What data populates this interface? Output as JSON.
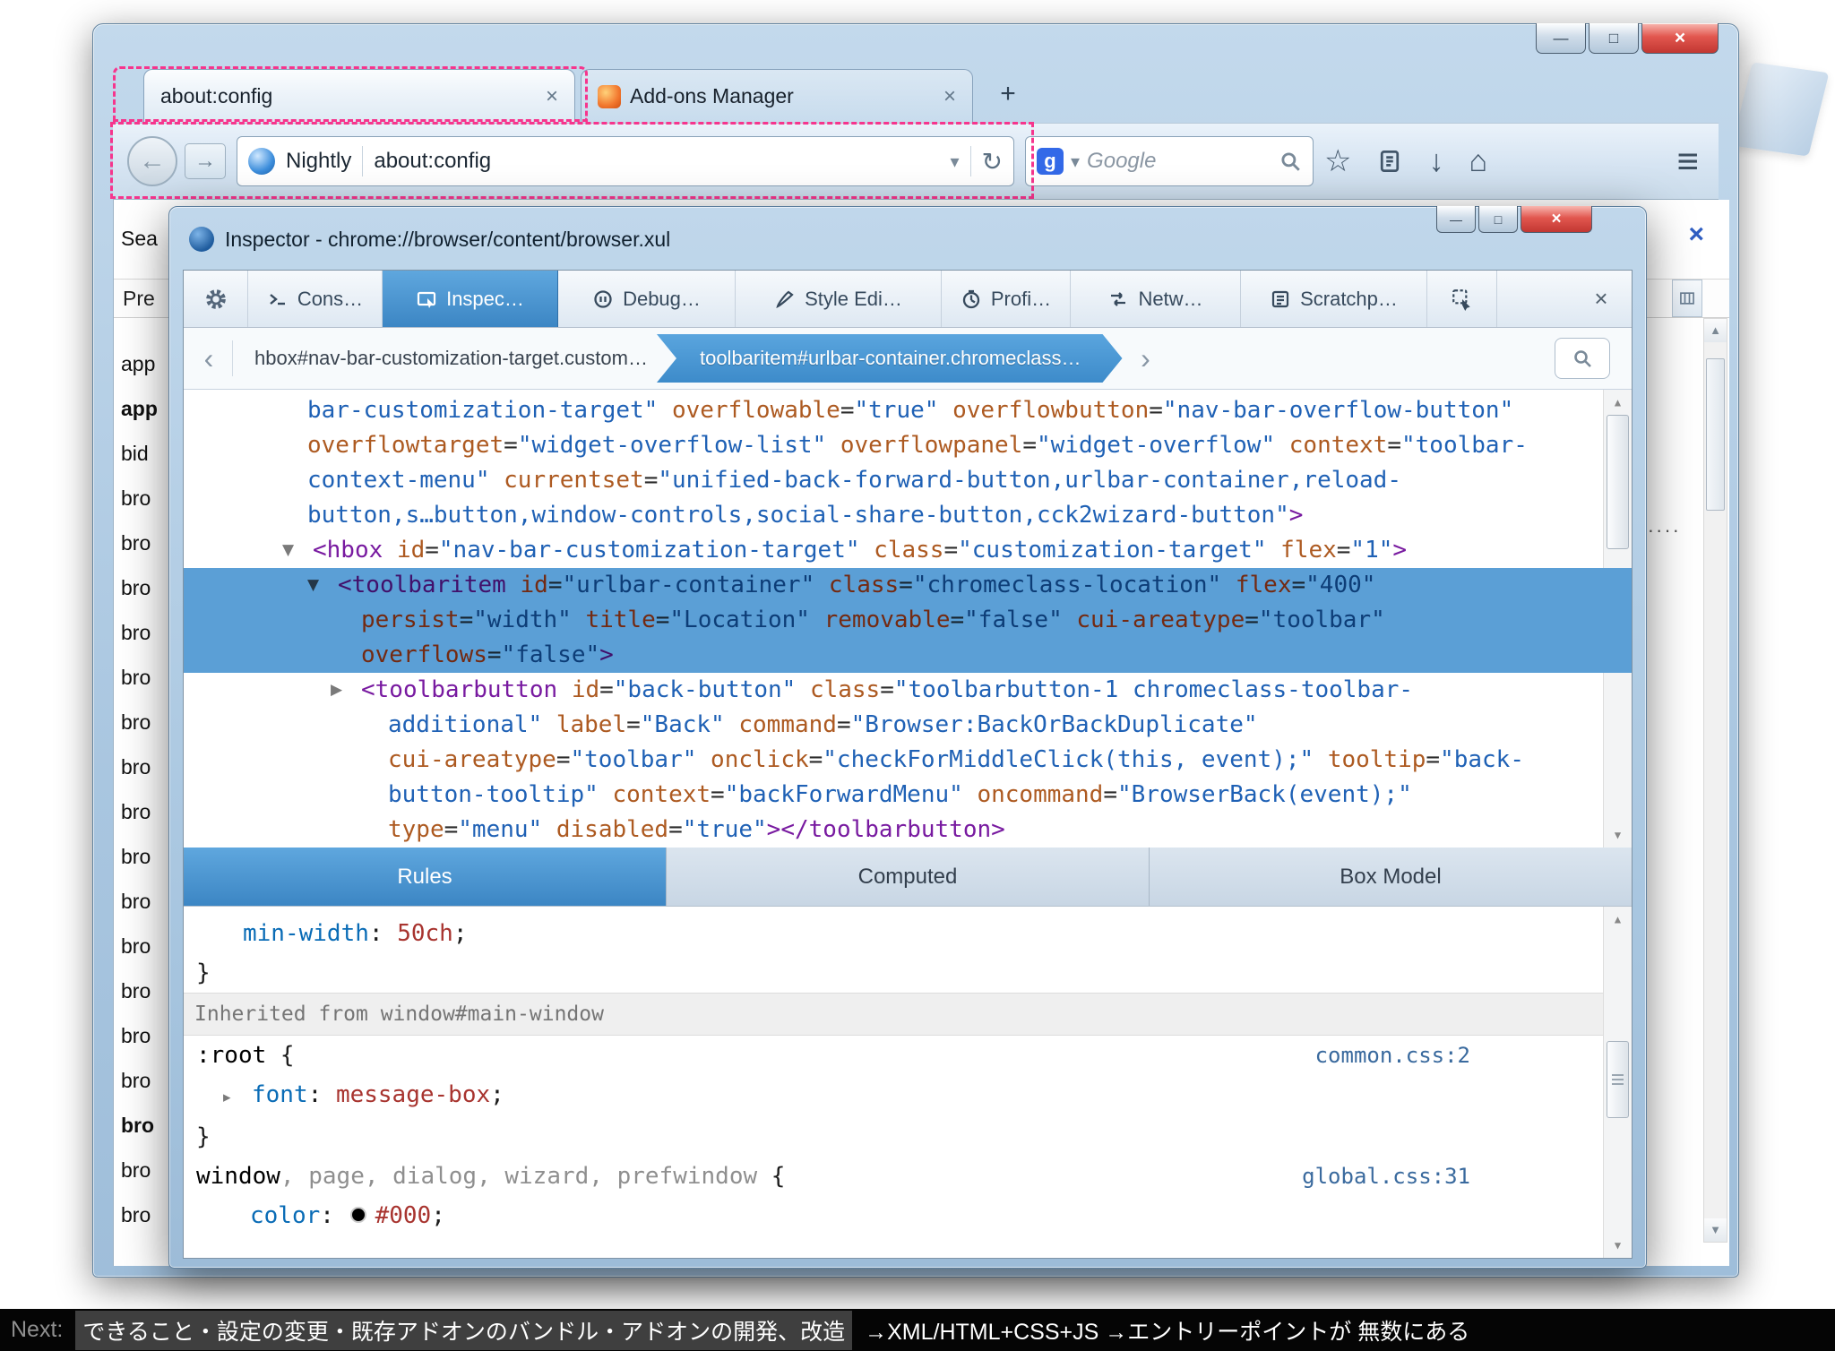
{
  "icons": {
    "close": "×",
    "minimize": "—",
    "maximize": "□",
    "plus": "+",
    "back": "←",
    "forward": "→",
    "dropdown": "▾",
    "reload": "↻",
    "star": "☆",
    "downloads": "↓",
    "home": "⌂",
    "menu": "≡",
    "chevron_left": "‹",
    "chevron_right": "›",
    "scroll_up": "▲",
    "scroll_down": "▼",
    "search_clear": "×",
    "google_glyph": "g"
  },
  "browser": {
    "tabs": [
      {
        "label": "about:config",
        "active": true
      },
      {
        "label": "Add-ons Manager",
        "active": false
      }
    ],
    "navbar": {
      "site_button_label": "Nightly",
      "url_value": "about:config",
      "search_placeholder": "Google"
    }
  },
  "about_config": {
    "search_label": "Sea",
    "header_label": "Pre",
    "truncated_value": "····",
    "rows": [
      {
        "t": "app"
      },
      {
        "t": "app",
        "b": true
      },
      {
        "t": "bid"
      },
      {
        "t": "bro"
      },
      {
        "t": "bro"
      },
      {
        "t": "bro"
      },
      {
        "t": "bro"
      },
      {
        "t": "bro"
      },
      {
        "t": "bro"
      },
      {
        "t": "bro"
      },
      {
        "t": "bro"
      },
      {
        "t": "bro"
      },
      {
        "t": "bro"
      },
      {
        "t": "bro"
      },
      {
        "t": "bro"
      },
      {
        "t": "bro"
      },
      {
        "t": "bro"
      },
      {
        "t": "bro",
        "b": true
      },
      {
        "t": "bro"
      },
      {
        "t": "bro"
      }
    ]
  },
  "inspector": {
    "title": "Inspector - chrome://browser/content/browser.xul",
    "toolbar": {
      "tabs": [
        {
          "label": "Cons…"
        },
        {
          "label": "Inspec…",
          "selected": true
        },
        {
          "label": "Debug…"
        },
        {
          "label": "Style Edi…"
        },
        {
          "label": "Profi…"
        },
        {
          "label": "Netw…"
        },
        {
          "label": "Scratchp…"
        }
      ]
    },
    "breadcrumbs": {
      "items": [
        {
          "label": "hbox#nav-bar-customization-target.custom…",
          "selected": false
        },
        {
          "label": "toolbaritem#urlbar-container.chromeclass…",
          "selected": true
        }
      ]
    },
    "markup": {
      "lines": [
        {
          "pad": 138,
          "segs": [
            [
              "v",
              "bar-customization-target\" "
            ],
            [
              "a",
              "overflowable"
            ],
            [
              "p",
              "="
            ],
            [
              "v",
              "\"true\""
            ],
            [
              "p",
              " "
            ],
            [
              "a",
              "overflowbutton"
            ],
            [
              "p",
              "="
            ],
            [
              "v",
              "\"nav-bar-overflow-button\""
            ]
          ]
        },
        {
          "pad": 138,
          "segs": [
            [
              "a",
              "overflowtarget"
            ],
            [
              "p",
              "="
            ],
            [
              "v",
              "\"widget-overflow-list\""
            ],
            [
              "p",
              " "
            ],
            [
              "a",
              "overflowpanel"
            ],
            [
              "p",
              "="
            ],
            [
              "v",
              "\"widget-overflow\""
            ],
            [
              "p",
              " "
            ],
            [
              "a",
              "context"
            ],
            [
              "p",
              "="
            ],
            [
              "v",
              "\"toolbar-"
            ]
          ]
        },
        {
          "pad": 138,
          "segs": [
            [
              "v",
              "context-menu\" "
            ],
            [
              "a",
              "currentset"
            ],
            [
              "p",
              "="
            ],
            [
              "v",
              "\"unified-back-forward-button,urlbar-container,reload-"
            ]
          ]
        },
        {
          "pad": 138,
          "segs": [
            [
              "v",
              "button,s…button,window-controls,social-share-button,cck2wizard-button\""
            ],
            [
              "t",
              ">"
            ]
          ]
        },
        {
          "pad": 144,
          "tw": "▼",
          "segs": [
            [
              "t",
              "<hbox"
            ],
            [
              "p",
              " "
            ],
            [
              "a",
              "id"
            ],
            [
              "p",
              "="
            ],
            [
              "v",
              "\"nav-bar-customization-target\""
            ],
            [
              "p",
              " "
            ],
            [
              "a",
              "class"
            ],
            [
              "p",
              "="
            ],
            [
              "v",
              "\"customization-target\""
            ],
            [
              "p",
              " "
            ],
            [
              "a",
              "flex"
            ],
            [
              "p",
              "="
            ],
            [
              "v",
              "\"1\""
            ],
            [
              "t",
              ">"
            ]
          ]
        },
        {
          "pad": 172,
          "tw": "▼",
          "sel": true,
          "segs": [
            [
              "t",
              "<toolbaritem"
            ],
            [
              "p",
              " "
            ],
            [
              "a",
              "id"
            ],
            [
              "p",
              "="
            ],
            [
              "v",
              "\"urlbar-container\""
            ],
            [
              "p",
              " "
            ],
            [
              "a",
              "class"
            ],
            [
              "p",
              "="
            ],
            [
              "v",
              "\"chromeclass-location\""
            ],
            [
              "p",
              " "
            ],
            [
              "a",
              "flex"
            ],
            [
              "p",
              "="
            ],
            [
              "v",
              "\"400\""
            ]
          ]
        },
        {
          "pad": 198,
          "sel": true,
          "segs": [
            [
              "a",
              "persist"
            ],
            [
              "p",
              "="
            ],
            [
              "v",
              "\"width\""
            ],
            [
              "p",
              " "
            ],
            [
              "a",
              "title"
            ],
            [
              "p",
              "="
            ],
            [
              "v",
              "\"Location\""
            ],
            [
              "p",
              " "
            ],
            [
              "a",
              "removable"
            ],
            [
              "p",
              "="
            ],
            [
              "v",
              "\"false\""
            ],
            [
              "p",
              " "
            ],
            [
              "a",
              "cui-areatype"
            ],
            [
              "p",
              "="
            ],
            [
              "v",
              "\"toolbar\""
            ]
          ]
        },
        {
          "pad": 198,
          "sel": true,
          "segs": [
            [
              "a",
              "overflows"
            ],
            [
              "p",
              "="
            ],
            [
              "v",
              "\"false\""
            ],
            [
              "t",
              ">"
            ]
          ]
        },
        {
          "pad": 198,
          "tw": "▶",
          "segs": [
            [
              "t",
              "<toolbarbutton"
            ],
            [
              "p",
              " "
            ],
            [
              "a",
              "id"
            ],
            [
              "p",
              "="
            ],
            [
              "v",
              "\"back-button\""
            ],
            [
              "p",
              " "
            ],
            [
              "a",
              "class"
            ],
            [
              "p",
              "="
            ],
            [
              "v",
              "\"toolbarbutton-1 chromeclass-toolbar-"
            ]
          ]
        },
        {
          "pad": 228,
          "segs": [
            [
              "v",
              "additional\" "
            ],
            [
              "a",
              "label"
            ],
            [
              "p",
              "="
            ],
            [
              "v",
              "\"Back\""
            ],
            [
              "p",
              " "
            ],
            [
              "a",
              "command"
            ],
            [
              "p",
              "="
            ],
            [
              "v",
              "\"Browser:BackOrBackDuplicate\""
            ]
          ]
        },
        {
          "pad": 228,
          "segs": [
            [
              "a",
              "cui-areatype"
            ],
            [
              "p",
              "="
            ],
            [
              "v",
              "\"toolbar\""
            ],
            [
              "p",
              " "
            ],
            [
              "a",
              "onclick"
            ],
            [
              "p",
              "="
            ],
            [
              "v",
              "\"checkForMiddleClick(this, event);\""
            ],
            [
              "p",
              " "
            ],
            [
              "a",
              "tooltip"
            ],
            [
              "p",
              "="
            ],
            [
              "v",
              "\"back-"
            ]
          ]
        },
        {
          "pad": 228,
          "segs": [
            [
              "v",
              "button-tooltip\" "
            ],
            [
              "a",
              "context"
            ],
            [
              "p",
              "="
            ],
            [
              "v",
              "\"backForwardMenu\""
            ],
            [
              "p",
              " "
            ],
            [
              "a",
              "oncommand"
            ],
            [
              "p",
              "="
            ],
            [
              "v",
              "\"BrowserBack(event);\""
            ]
          ]
        },
        {
          "pad": 228,
          "segs": [
            [
              "a",
              "type"
            ],
            [
              "p",
              "="
            ],
            [
              "v",
              "\"menu\""
            ],
            [
              "p",
              " "
            ],
            [
              "a",
              "disabled"
            ],
            [
              "p",
              "="
            ],
            [
              "v",
              "\"true\""
            ],
            [
              "t",
              "></toolbarbutton>"
            ]
          ]
        }
      ]
    },
    "sidebar_tabs": [
      {
        "label": "Rules",
        "selected": true
      },
      {
        "label": "Computed",
        "selected": false
      },
      {
        "label": "Box Model",
        "selected": false
      }
    ],
    "rules": {
      "lines": [
        {
          "type": "decl",
          "pad": 66,
          "prop": "min-width",
          "value": "50ch"
        },
        {
          "type": "close",
          "pad": 14
        },
        {
          "type": "header",
          "text": "Inherited from window#main-window"
        },
        {
          "type": "selector",
          "pad": 14,
          "parts": [
            [
              "m",
              ":root"
            ]
          ],
          "link": "common.css:2"
        },
        {
          "type": "decl",
          "pad": 44,
          "tw": "▸",
          "prop": "font",
          "value": "message-box"
        },
        {
          "type": "close",
          "pad": 14
        },
        {
          "type": "selector",
          "pad": 14,
          "parts": [
            [
              "m",
              "window"
            ],
            [
              "u",
              ", page, dialog, wizard, prefwindow"
            ]
          ],
          "link": "global.css:31"
        },
        {
          "type": "decl",
          "pad": 74,
          "prop": "color",
          "swatch": "#000",
          "value": "#000"
        }
      ]
    }
  },
  "footer": {
    "next_label": "Next:",
    "highlight": "できること・設定の変更・既存アドオンのバンドル・アドオンの開発、改造",
    "rest": "→XML/HTML+CSS+JS →エントリーポイントが 無数にある"
  }
}
